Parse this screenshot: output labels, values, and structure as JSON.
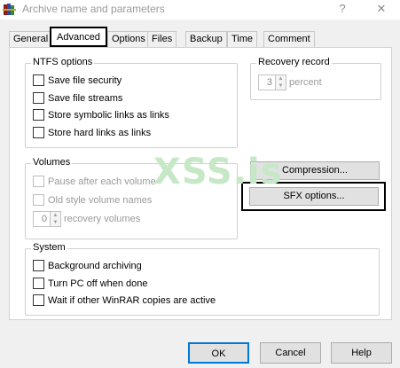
{
  "window": {
    "title": "Archive name and parameters",
    "help_glyph": "?",
    "close_glyph": "✕",
    "app_icon": "winrar-books-icon"
  },
  "tabs": [
    {
      "label": "General"
    },
    {
      "label": "Advanced",
      "active": true
    },
    {
      "label": "Options"
    },
    {
      "label": "Files"
    },
    {
      "label": "Backup"
    },
    {
      "label": "Time"
    },
    {
      "label": "Comment"
    }
  ],
  "ntfs": {
    "title": "NTFS options",
    "items": [
      {
        "label": "Save file security",
        "checked": false
      },
      {
        "label": "Save file streams",
        "checked": false
      },
      {
        "label": "Store symbolic links as links",
        "checked": false
      },
      {
        "label": "Store hard links as links",
        "checked": false
      }
    ]
  },
  "recovery": {
    "title": "Recovery record",
    "value": "3",
    "unit": "percent"
  },
  "volumes": {
    "title": "Volumes",
    "pause_label": "Pause after each volume",
    "old_style_label": "Old style volume names",
    "recovery_value": "0",
    "recovery_label": "recovery volumes"
  },
  "buttons": {
    "compression": "Compression...",
    "sfx": "SFX options...",
    "ok": "OK",
    "cancel": "Cancel",
    "help": "Help"
  },
  "system": {
    "title": "System",
    "items": [
      {
        "label": "Background archiving",
        "checked": false
      },
      {
        "label": "Turn PC off when done",
        "checked": false
      },
      {
        "label": "Wait if other WinRAR copies are active",
        "checked": false
      }
    ]
  },
  "watermark": "XSS.is"
}
